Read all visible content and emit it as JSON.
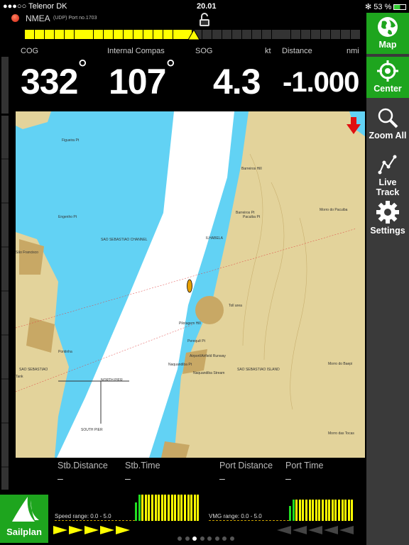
{
  "status_bar": {
    "carrier": "●●●○○ Telenor DK",
    "time": "20.01",
    "battery": "53 %"
  },
  "connection": {
    "name": "NMEA",
    "detail": "(UDP) Port no.1703",
    "status_color": "#e03020"
  },
  "gauge": {
    "segments": 34,
    "filled": 17,
    "fill_color": "#ffff00"
  },
  "instruments": {
    "cog_label": "COG",
    "compass_label": "Internal Compas",
    "sog_label": "SOG",
    "sog_unit": "kt",
    "distance_label": "Distance",
    "distance_unit": "nmi",
    "cog_value": "332",
    "compass_value": "107",
    "degree": "°",
    "sog_value": "4.3",
    "distance_value": "-1.000"
  },
  "sidebar": {
    "items": [
      {
        "label": "Map",
        "icon": "globe-icon",
        "active": true
      },
      {
        "label": "Center",
        "icon": "crosshair-icon",
        "active": true
      },
      {
        "label": "Zoom All",
        "icon": "magnifier-icon"
      },
      {
        "label": "Live Track",
        "icon": "track-icon"
      },
      {
        "label": "Settings",
        "icon": "gear-icon"
      }
    ]
  },
  "map": {
    "labels": [
      "SAO SEBASTIAO CHANNEL",
      "ILHABELA",
      "Barreiros Hill",
      "Barreiros Pt",
      "Morro do Pacuiba",
      "Pacuiba Pt",
      "Perequê Pt",
      "Airport/Airfield Runway",
      "Naquandiba Stream",
      "SAO SEBASTIAO ISLAND",
      "Naquandiba Pt",
      "Morro do Baepi",
      "Morro das Tocas",
      "SAO SEBASTIAO",
      "NORTH PIER",
      "SOUTH PIER",
      "Pontinha",
      "Tank",
      "São Francisco",
      "Figueira Pt",
      "Engenho Pt",
      "Pilotagem Hill",
      "Toll area"
    ]
  },
  "info": {
    "stb_distance_label": "Stb.Distance",
    "stb_time_label": "Stb.Time",
    "port_distance_label": "Port Distance",
    "port_time_label": "Port Time",
    "stb_distance": "–",
    "stb_time": "–",
    "port_distance": "–",
    "port_time": "–"
  },
  "bottom": {
    "sailplan_label": "Sailplan",
    "speed_range": "Speed range: 0.0 - 5.0",
    "vmg_range": "VMG range: 0.0 - 5.0",
    "stb_arrows": 5,
    "port_arrows": 5
  },
  "pager": {
    "count": 8,
    "active": 2
  }
}
